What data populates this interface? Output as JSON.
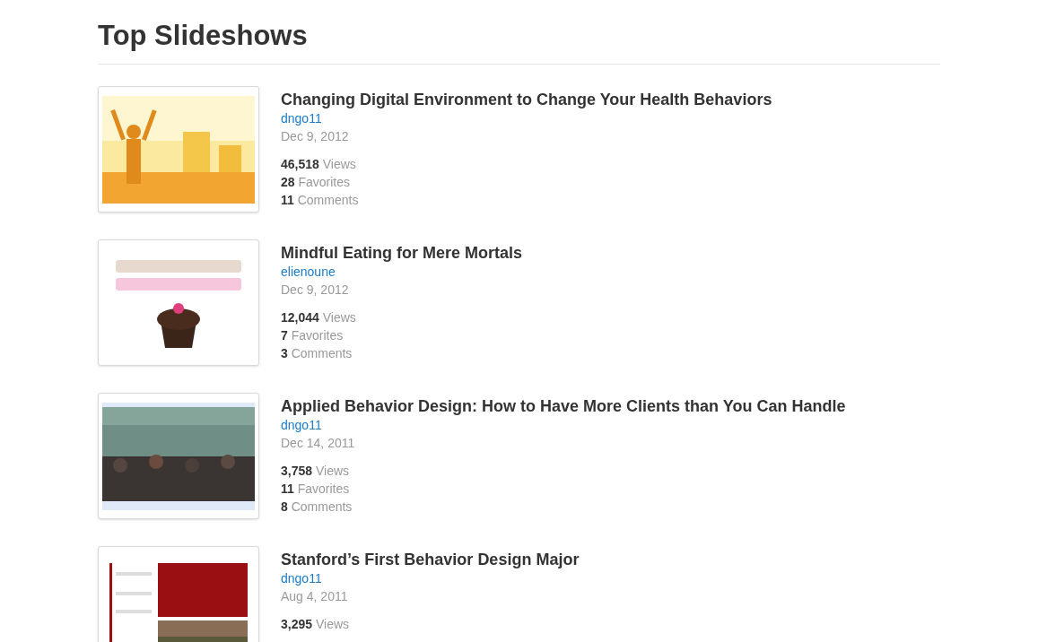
{
  "heading": "Top Slideshows",
  "slideshows": [
    {
      "thumbnail": {
        "kind": "picture"
      },
      "title": "Changing Digital Environment to Change Your Health Behaviors",
      "author": "dngo11",
      "date": "Dec 9, 2012",
      "stats": [
        {
          "count": "46,518",
          "label": "Views"
        },
        {
          "count": "28",
          "label": "Favorites"
        },
        {
          "count": "11",
          "label": "Comments"
        }
      ]
    },
    {
      "thumbnail": {
        "kind": "picture"
      },
      "title": "Mindful Eating for Mere Mortals",
      "author": "elienoune",
      "date": "Dec 9, 2012",
      "stats": [
        {
          "count": "12,044",
          "label": "Views"
        },
        {
          "count": "7",
          "label": "Favorites"
        },
        {
          "count": "3",
          "label": "Comments"
        }
      ]
    },
    {
      "thumbnail": {
        "kind": "picture"
      },
      "title": "Applied Behavior Design: How to Have More Clients than You Can Handle",
      "author": "dngo11",
      "date": "Dec 14, 2011",
      "stats": [
        {
          "count": "3,758",
          "label": "Views"
        },
        {
          "count": "11",
          "label": "Favorites"
        },
        {
          "count": "8",
          "label": "Comments"
        }
      ]
    },
    {
      "thumbnail": {
        "kind": "picture"
      },
      "title": "Stanford’s First Behavior Design Major",
      "author": "dngo11",
      "date": "Aug 4, 2011",
      "stats": [
        {
          "count": "3,295",
          "label": "Views"
        }
      ]
    }
  ]
}
